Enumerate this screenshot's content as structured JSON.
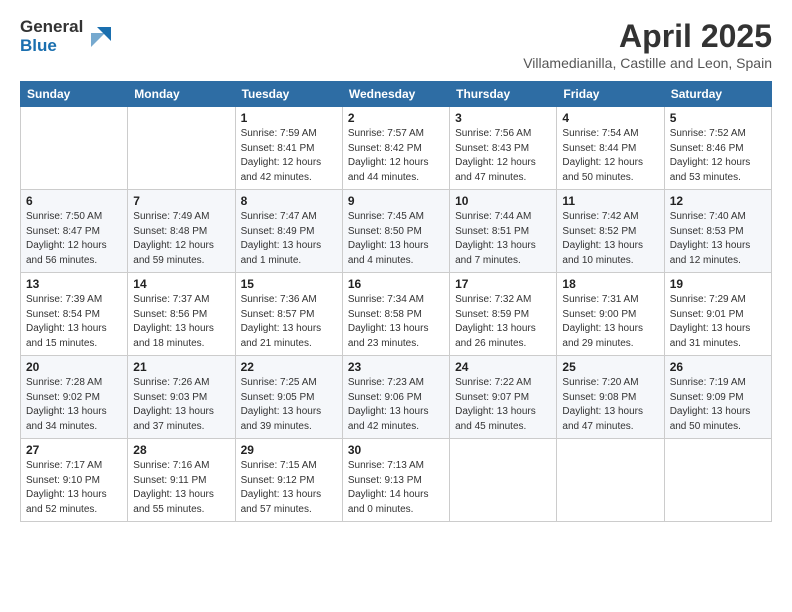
{
  "logo": {
    "general": "General",
    "blue": "Blue"
  },
  "title": "April 2025",
  "location": "Villamedianilla, Castille and Leon, Spain",
  "days_of_week": [
    "Sunday",
    "Monday",
    "Tuesday",
    "Wednesday",
    "Thursday",
    "Friday",
    "Saturday"
  ],
  "weeks": [
    [
      null,
      null,
      {
        "day": "1",
        "sunrise": "Sunrise: 7:59 AM",
        "sunset": "Sunset: 8:41 PM",
        "daylight": "Daylight: 12 hours and 42 minutes."
      },
      {
        "day": "2",
        "sunrise": "Sunrise: 7:57 AM",
        "sunset": "Sunset: 8:42 PM",
        "daylight": "Daylight: 12 hours and 44 minutes."
      },
      {
        "day": "3",
        "sunrise": "Sunrise: 7:56 AM",
        "sunset": "Sunset: 8:43 PM",
        "daylight": "Daylight: 12 hours and 47 minutes."
      },
      {
        "day": "4",
        "sunrise": "Sunrise: 7:54 AM",
        "sunset": "Sunset: 8:44 PM",
        "daylight": "Daylight: 12 hours and 50 minutes."
      },
      {
        "day": "5",
        "sunrise": "Sunrise: 7:52 AM",
        "sunset": "Sunset: 8:46 PM",
        "daylight": "Daylight: 12 hours and 53 minutes."
      }
    ],
    [
      {
        "day": "6",
        "sunrise": "Sunrise: 7:50 AM",
        "sunset": "Sunset: 8:47 PM",
        "daylight": "Daylight: 12 hours and 56 minutes."
      },
      {
        "day": "7",
        "sunrise": "Sunrise: 7:49 AM",
        "sunset": "Sunset: 8:48 PM",
        "daylight": "Daylight: 12 hours and 59 minutes."
      },
      {
        "day": "8",
        "sunrise": "Sunrise: 7:47 AM",
        "sunset": "Sunset: 8:49 PM",
        "daylight": "Daylight: 13 hours and 1 minute."
      },
      {
        "day": "9",
        "sunrise": "Sunrise: 7:45 AM",
        "sunset": "Sunset: 8:50 PM",
        "daylight": "Daylight: 13 hours and 4 minutes."
      },
      {
        "day": "10",
        "sunrise": "Sunrise: 7:44 AM",
        "sunset": "Sunset: 8:51 PM",
        "daylight": "Daylight: 13 hours and 7 minutes."
      },
      {
        "day": "11",
        "sunrise": "Sunrise: 7:42 AM",
        "sunset": "Sunset: 8:52 PM",
        "daylight": "Daylight: 13 hours and 10 minutes."
      },
      {
        "day": "12",
        "sunrise": "Sunrise: 7:40 AM",
        "sunset": "Sunset: 8:53 PM",
        "daylight": "Daylight: 13 hours and 12 minutes."
      }
    ],
    [
      {
        "day": "13",
        "sunrise": "Sunrise: 7:39 AM",
        "sunset": "Sunset: 8:54 PM",
        "daylight": "Daylight: 13 hours and 15 minutes."
      },
      {
        "day": "14",
        "sunrise": "Sunrise: 7:37 AM",
        "sunset": "Sunset: 8:56 PM",
        "daylight": "Daylight: 13 hours and 18 minutes."
      },
      {
        "day": "15",
        "sunrise": "Sunrise: 7:36 AM",
        "sunset": "Sunset: 8:57 PM",
        "daylight": "Daylight: 13 hours and 21 minutes."
      },
      {
        "day": "16",
        "sunrise": "Sunrise: 7:34 AM",
        "sunset": "Sunset: 8:58 PM",
        "daylight": "Daylight: 13 hours and 23 minutes."
      },
      {
        "day": "17",
        "sunrise": "Sunrise: 7:32 AM",
        "sunset": "Sunset: 8:59 PM",
        "daylight": "Daylight: 13 hours and 26 minutes."
      },
      {
        "day": "18",
        "sunrise": "Sunrise: 7:31 AM",
        "sunset": "Sunset: 9:00 PM",
        "daylight": "Daylight: 13 hours and 29 minutes."
      },
      {
        "day": "19",
        "sunrise": "Sunrise: 7:29 AM",
        "sunset": "Sunset: 9:01 PM",
        "daylight": "Daylight: 13 hours and 31 minutes."
      }
    ],
    [
      {
        "day": "20",
        "sunrise": "Sunrise: 7:28 AM",
        "sunset": "Sunset: 9:02 PM",
        "daylight": "Daylight: 13 hours and 34 minutes."
      },
      {
        "day": "21",
        "sunrise": "Sunrise: 7:26 AM",
        "sunset": "Sunset: 9:03 PM",
        "daylight": "Daylight: 13 hours and 37 minutes."
      },
      {
        "day": "22",
        "sunrise": "Sunrise: 7:25 AM",
        "sunset": "Sunset: 9:05 PM",
        "daylight": "Daylight: 13 hours and 39 minutes."
      },
      {
        "day": "23",
        "sunrise": "Sunrise: 7:23 AM",
        "sunset": "Sunset: 9:06 PM",
        "daylight": "Daylight: 13 hours and 42 minutes."
      },
      {
        "day": "24",
        "sunrise": "Sunrise: 7:22 AM",
        "sunset": "Sunset: 9:07 PM",
        "daylight": "Daylight: 13 hours and 45 minutes."
      },
      {
        "day": "25",
        "sunrise": "Sunrise: 7:20 AM",
        "sunset": "Sunset: 9:08 PM",
        "daylight": "Daylight: 13 hours and 47 minutes."
      },
      {
        "day": "26",
        "sunrise": "Sunrise: 7:19 AM",
        "sunset": "Sunset: 9:09 PM",
        "daylight": "Daylight: 13 hours and 50 minutes."
      }
    ],
    [
      {
        "day": "27",
        "sunrise": "Sunrise: 7:17 AM",
        "sunset": "Sunset: 9:10 PM",
        "daylight": "Daylight: 13 hours and 52 minutes."
      },
      {
        "day": "28",
        "sunrise": "Sunrise: 7:16 AM",
        "sunset": "Sunset: 9:11 PM",
        "daylight": "Daylight: 13 hours and 55 minutes."
      },
      {
        "day": "29",
        "sunrise": "Sunrise: 7:15 AM",
        "sunset": "Sunset: 9:12 PM",
        "daylight": "Daylight: 13 hours and 57 minutes."
      },
      {
        "day": "30",
        "sunrise": "Sunrise: 7:13 AM",
        "sunset": "Sunset: 9:13 PM",
        "daylight": "Daylight: 14 hours and 0 minutes."
      },
      null,
      null,
      null
    ]
  ]
}
